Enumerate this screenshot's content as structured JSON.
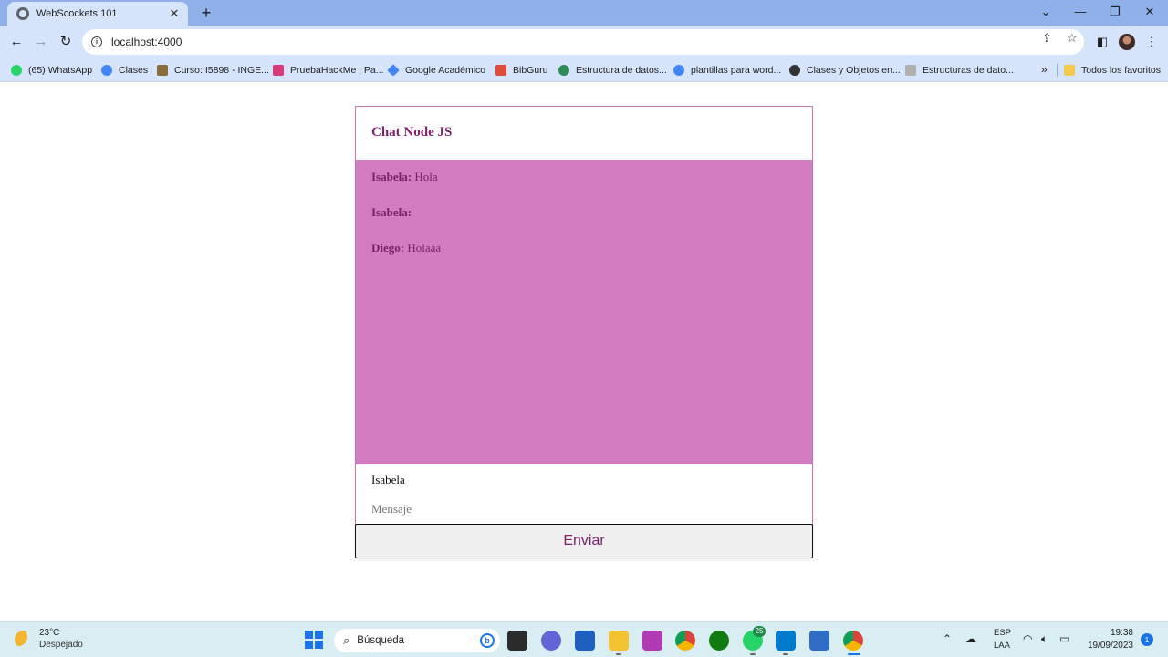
{
  "browser": {
    "tab_title": "WebScockets 101",
    "tab_close": "✕",
    "new_tab": "+",
    "url": "localhost:4000",
    "window_controls": {
      "minimize": "—",
      "maximize": "❐",
      "close": "✕",
      "tab_list": "⌄"
    }
  },
  "bookmarks": [
    {
      "label": "(65) WhatsApp",
      "icon": "whatsapp-icon",
      "color": "#25d366"
    },
    {
      "label": "Clases",
      "icon": "google-icon",
      "color": "#4285f4"
    },
    {
      "label": "Curso: I5898 - INGE...",
      "icon": "course-icon",
      "color": "#8a6d3b"
    },
    {
      "label": "PruebaHackMe | Pa...",
      "icon": "cloud-icon",
      "color": "#d93a7a"
    },
    {
      "label": "Google Académico",
      "icon": "scholar-icon",
      "color": "#4285f4"
    },
    {
      "label": "BibGuru",
      "icon": "bibguru-icon",
      "color": "#e04b3a"
    },
    {
      "label": "Estructura de datos...",
      "icon": "globe-icon",
      "color": "#2e8b57"
    },
    {
      "label": "plantillas para word...",
      "icon": "google-icon",
      "color": "#4285f4"
    },
    {
      "label": "Clases y Objetos en...",
      "icon": "site-icon",
      "color": "#333333"
    },
    {
      "label": "Estructuras de dato...",
      "icon": "page-icon",
      "color": "#b0b0b0"
    }
  ],
  "bookmarks_more": "»",
  "all_bookmarks": "Todos los favoritos",
  "chat": {
    "title": "Chat Node JS",
    "messages": [
      {
        "user": "Isabela:",
        "text": " Hola"
      },
      {
        "user": "Isabela:",
        "text": ""
      },
      {
        "user": "Diego:",
        "text": " Holaaa"
      }
    ],
    "username_value": "Isabela",
    "message_placeholder": "Mensaje",
    "send_label": "Enviar",
    "colors": {
      "panel": "#d17dc0",
      "text": "#7b1f6a"
    }
  },
  "taskbar": {
    "temperature": "23°C",
    "condition": "Despejado",
    "search_placeholder": "Búsqueda",
    "whatsapp_badge": "25",
    "lang_primary": "ESP",
    "lang_secondary": "LAA",
    "time": "19:38",
    "date": "19/09/2023",
    "notifications": "1"
  }
}
